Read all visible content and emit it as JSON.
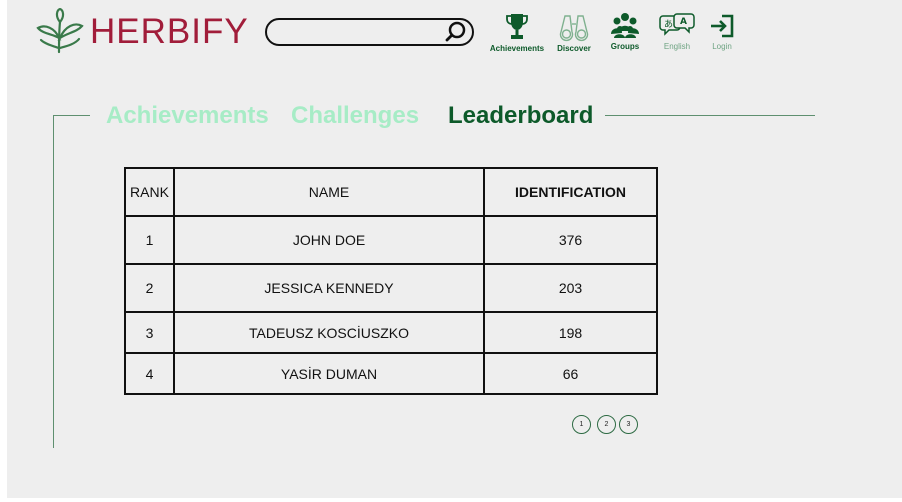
{
  "brand": {
    "name": "HERBIFY",
    "color": "#a11d3a"
  },
  "search": {
    "placeholder": ""
  },
  "nav": [
    {
      "label": "Achievements",
      "icon": "trophy-icon"
    },
    {
      "label": "Discover",
      "icon": "binoculars-icon"
    },
    {
      "label": "Groups",
      "icon": "group-icon"
    },
    {
      "label": "English",
      "icon": "language-icon"
    },
    {
      "label": "Login",
      "icon": "login-icon"
    }
  ],
  "tabs": [
    {
      "label": "Achievements",
      "active": false
    },
    {
      "label": "Challenges",
      "active": false
    },
    {
      "label": "Leaderboard",
      "active": true
    }
  ],
  "table": {
    "headers": [
      "RANK",
      "NAME",
      "IDENTIFICATION"
    ],
    "rows": [
      [
        "1",
        "JOHN DOE",
        "376"
      ],
      [
        "2",
        "JESSICA KENNEDY",
        "203"
      ],
      [
        "3",
        "TADEUSZ KOSCİUSZKO",
        "198"
      ],
      [
        "4",
        "YASİR DUMAN",
        "66"
      ]
    ]
  },
  "pagination": [
    "1",
    "2",
    "3"
  ],
  "colors": {
    "accent": "#0d5a2a",
    "inactive_tab": "#a7ecc6",
    "background": "#eeeeee"
  }
}
